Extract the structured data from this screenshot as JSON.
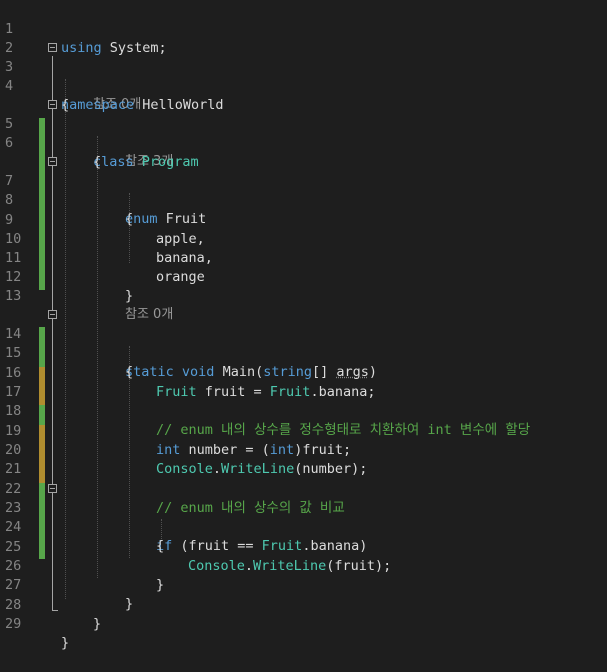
{
  "editor": {
    "code_lens": {
      "l4": "참조 0개",
      "l6": "참조 3개",
      "l13": "참조 0개"
    },
    "lines": [
      {
        "num": "1",
        "tokens": [
          {
            "t": "using",
            "c": "kw"
          },
          {
            "t": " System;",
            "c": "id"
          }
        ]
      },
      {
        "num": "2",
        "tokens": []
      },
      {
        "num": "3",
        "tokens": [
          {
            "t": "namespace",
            "c": "kw"
          },
          {
            "t": " HelloWorld",
            "c": "id"
          }
        ]
      },
      {
        "num": "4",
        "tokens": [
          {
            "t": "{",
            "c": "id"
          }
        ]
      },
      {
        "num": "5",
        "tokens": [
          {
            "t": "class",
            "c": "kw"
          },
          {
            "t": " ",
            "c": "id"
          },
          {
            "t": "Program",
            "c": "ty"
          }
        ]
      },
      {
        "num": "6",
        "tokens": [
          {
            "t": "{",
            "c": "id"
          }
        ]
      },
      {
        "num": "7",
        "tokens": [
          {
            "t": "enum",
            "c": "kw"
          },
          {
            "t": " ",
            "c": "id"
          },
          {
            "t": "Fruit",
            "c": "id"
          }
        ]
      },
      {
        "num": "8",
        "tokens": [
          {
            "t": "{",
            "c": "id"
          }
        ]
      },
      {
        "num": "9",
        "tokens": [
          {
            "t": "apple,",
            "c": "id"
          }
        ]
      },
      {
        "num": "10",
        "tokens": [
          {
            "t": "banana,",
            "c": "id"
          }
        ]
      },
      {
        "num": "11",
        "tokens": [
          {
            "t": "orange",
            "c": "id"
          }
        ]
      },
      {
        "num": "12",
        "tokens": [
          {
            "t": "}",
            "c": "id"
          }
        ]
      },
      {
        "num": "13",
        "tokens": []
      },
      {
        "num": "14",
        "tokens": [
          {
            "t": "static",
            "c": "kw"
          },
          {
            "t": " ",
            "c": "id"
          },
          {
            "t": "void",
            "c": "kw"
          },
          {
            "t": " Main(",
            "c": "id"
          },
          {
            "t": "string",
            "c": "kw"
          },
          {
            "t": "[] ",
            "c": "id"
          },
          {
            "t": "args",
            "c": "sq"
          },
          {
            "t": ")",
            "c": "id"
          }
        ]
      },
      {
        "num": "15",
        "tokens": [
          {
            "t": "{",
            "c": "id"
          }
        ]
      },
      {
        "num": "16",
        "tokens": [
          {
            "t": "Fruit",
            "c": "ty"
          },
          {
            "t": " fruit = ",
            "c": "id"
          },
          {
            "t": "Fruit",
            "c": "ty"
          },
          {
            "t": ".banana;",
            "c": "id"
          }
        ]
      },
      {
        "num": "17",
        "tokens": []
      },
      {
        "num": "18",
        "tokens": [
          {
            "t": "// enum 내의 상수를 정수형태로 치환하여 int 변수에 할당",
            "c": "cm"
          }
        ]
      },
      {
        "num": "19",
        "tokens": [
          {
            "t": "int",
            "c": "kw"
          },
          {
            "t": " number = (",
            "c": "id"
          },
          {
            "t": "int",
            "c": "kw"
          },
          {
            "t": ")fruit;",
            "c": "id"
          }
        ]
      },
      {
        "num": "20",
        "tokens": [
          {
            "t": "Console",
            "c": "ty"
          },
          {
            "t": ".",
            "c": "id"
          },
          {
            "t": "WriteLine",
            "c": "ty"
          },
          {
            "t": "(number);",
            "c": "id"
          }
        ]
      },
      {
        "num": "21",
        "tokens": []
      },
      {
        "num": "22",
        "tokens": [
          {
            "t": "// enum 내의 상수의 값 비교",
            "c": "cm"
          }
        ]
      },
      {
        "num": "23",
        "tokens": [
          {
            "t": "if",
            "c": "kw"
          },
          {
            "t": " (fruit == ",
            "c": "id"
          },
          {
            "t": "Fruit",
            "c": "ty"
          },
          {
            "t": ".banana)",
            "c": "id"
          }
        ]
      },
      {
        "num": "24",
        "tokens": [
          {
            "t": "{",
            "c": "id"
          }
        ]
      },
      {
        "num": "25",
        "tokens": [
          {
            "t": "Console",
            "c": "ty"
          },
          {
            "t": ".",
            "c": "id"
          },
          {
            "t": "WriteLine",
            "c": "ty"
          },
          {
            "t": "(fruit);",
            "c": "id"
          }
        ]
      },
      {
        "num": "26",
        "tokens": [
          {
            "t": "}",
            "c": "id"
          }
        ]
      },
      {
        "num": "27",
        "tokens": [
          {
            "t": "}",
            "c": "id"
          }
        ]
      },
      {
        "num": "28",
        "tokens": [
          {
            "t": "}",
            "c": "id"
          }
        ]
      },
      {
        "num": "29",
        "tokens": [
          {
            "t": "}",
            "c": "id"
          }
        ]
      }
    ]
  },
  "colors": {
    "background": "#1e1e1e",
    "keyword": "#569cd6",
    "type": "#4ec9b0",
    "comment": "#57a64a",
    "identifier": "#dcdcdc",
    "line_number": "#858585",
    "change_saved": "#57a64a",
    "change_unsaved": "#b08d2f"
  }
}
